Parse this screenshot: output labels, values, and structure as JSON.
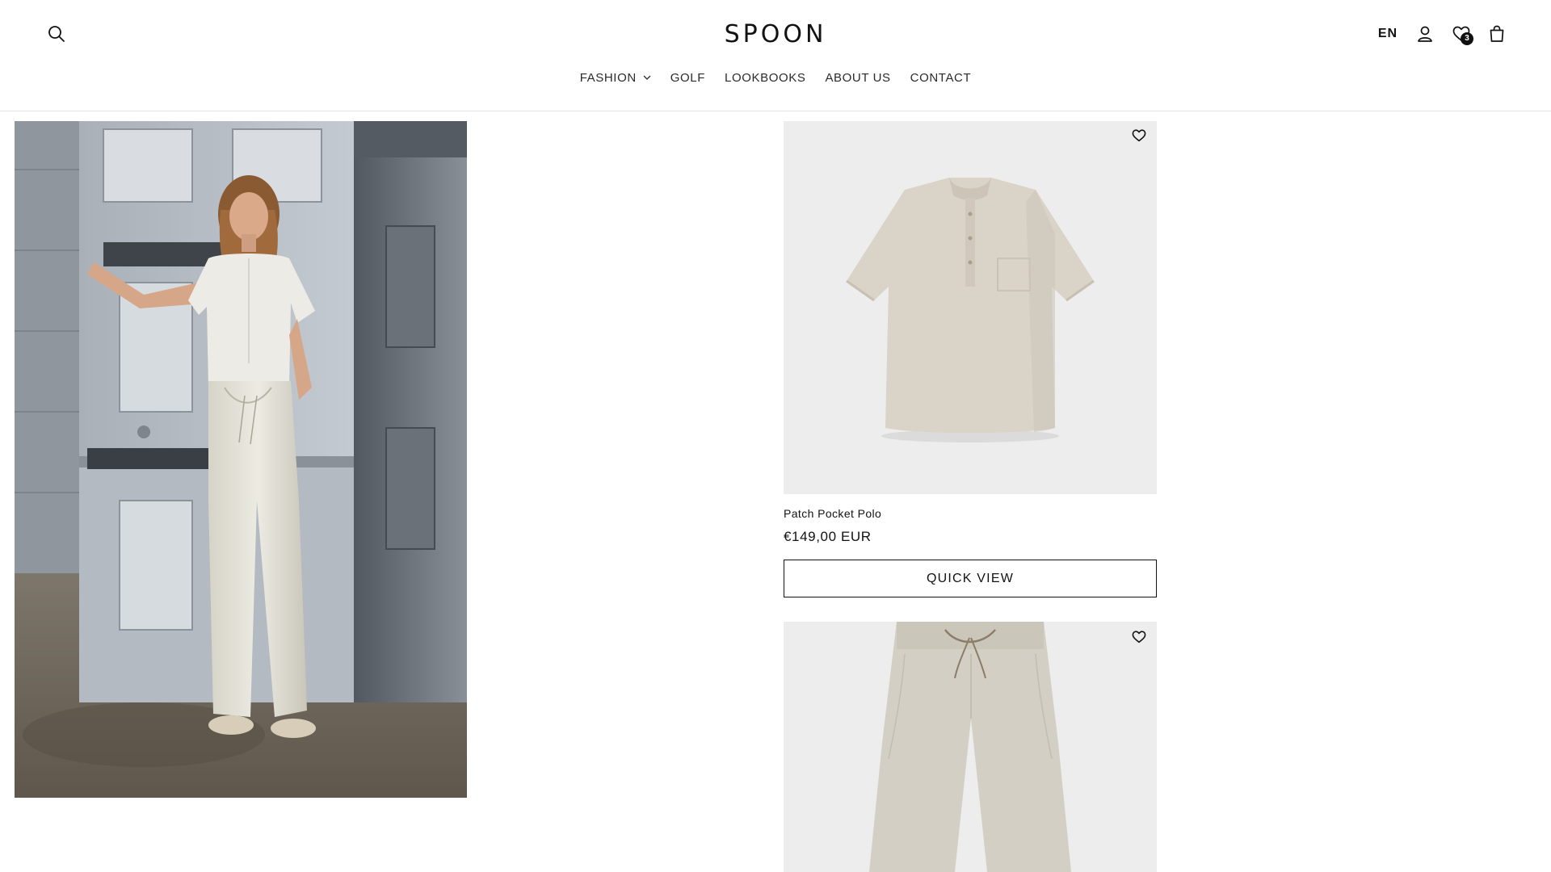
{
  "header": {
    "logo_text": "SPOON",
    "language": "EN",
    "wishlist_count": "3",
    "icons": [
      "search-icon",
      "account-icon",
      "wishlist-heart-icon",
      "cart-bag-icon"
    ]
  },
  "nav": {
    "items": [
      {
        "label": "FASHION",
        "has_dropdown": true
      },
      {
        "label": "GOLF"
      },
      {
        "label": "LOOKBOOKS"
      },
      {
        "label": "ABOUT US"
      },
      {
        "label": "CONTACT"
      }
    ]
  },
  "products": [
    {
      "title": "Patch Pocket Polo",
      "price": "€149,00 EUR",
      "button_label": "QUICK VIEW"
    },
    {
      "title": "",
      "price": ""
    }
  ],
  "colors": {
    "text": "#121212",
    "product_bg": "#ededed",
    "border": "#e6e6e6",
    "garment": "#d9d3c8"
  }
}
